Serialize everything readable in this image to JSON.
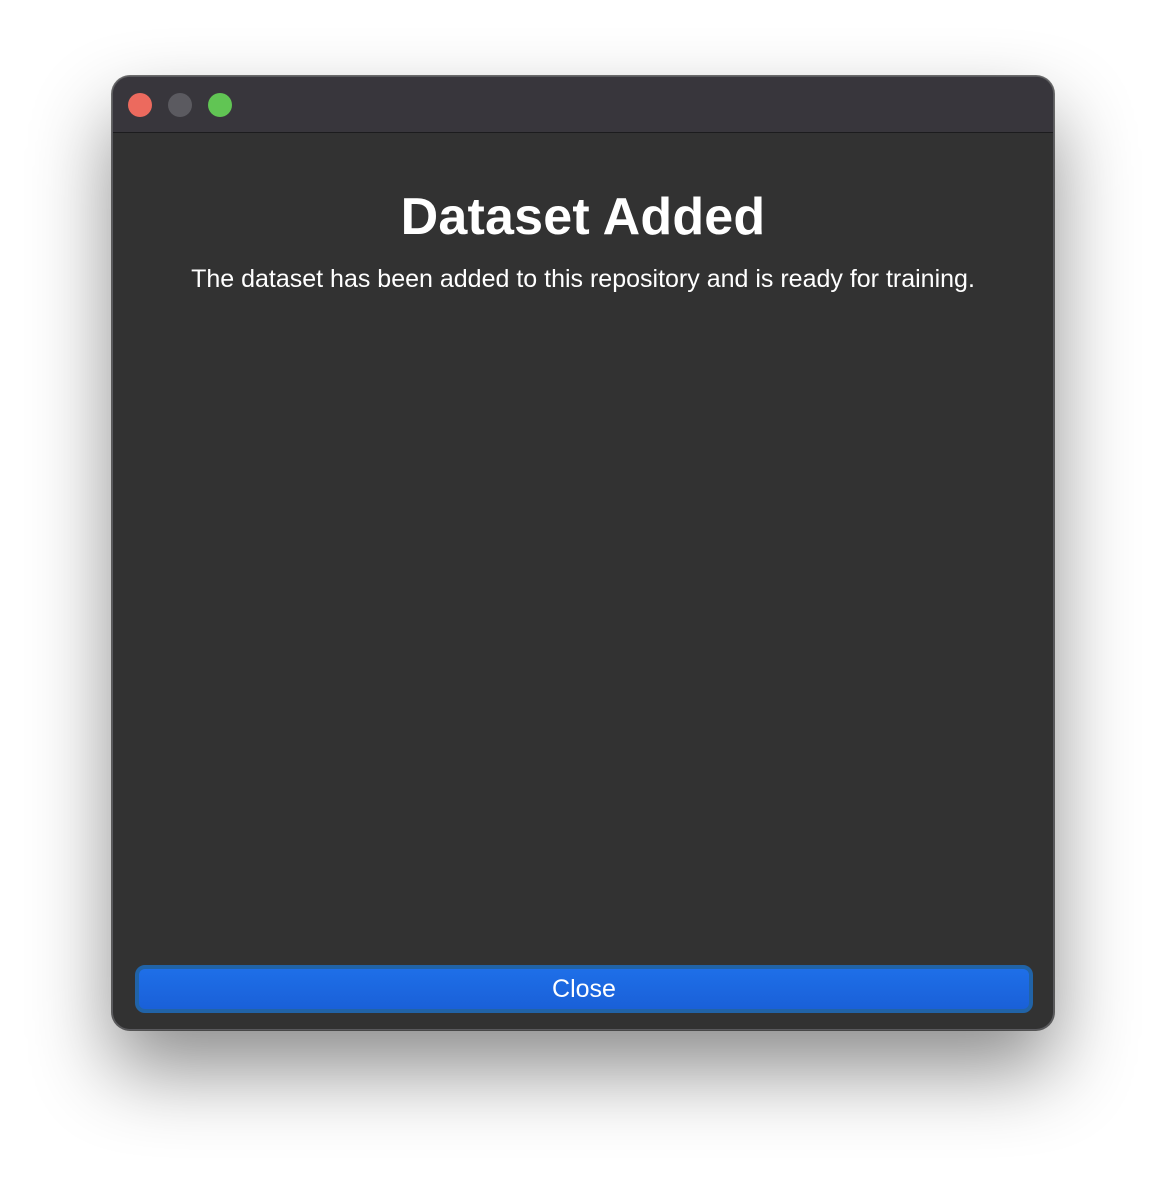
{
  "window": {
    "controls": [
      {
        "name": "close",
        "icon": "close-traffic-light-icon",
        "color": "#ec6a5e"
      },
      {
        "name": "minimize",
        "icon": "minimize-traffic-light-icon",
        "color": "#5b5a60"
      },
      {
        "name": "zoom",
        "icon": "zoom-traffic-light-icon",
        "color": "#61c554"
      }
    ]
  },
  "dialog": {
    "title": "Dataset Added",
    "message": "The dataset has been added to this repository and is ready for training.",
    "close_label": "Close"
  },
  "colors": {
    "background": "#323232",
    "titlebar": "#38363c",
    "accent": "#1a66e0"
  }
}
